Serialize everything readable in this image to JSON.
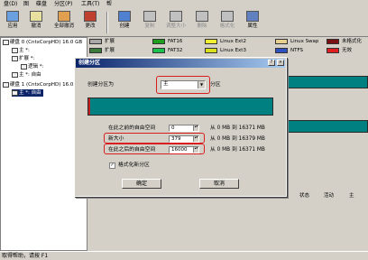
{
  "menubar": [
    "盘(D)",
    "图",
    "碟盘",
    "分区(P)",
    "工具(T)",
    "帮"
  ],
  "toolbar": {
    "buttons": [
      {
        "label": "应用",
        "icon": "apply-icon",
        "enabled": true
      },
      {
        "label": "撤消",
        "icon": "undo-icon",
        "enabled": true
      },
      {
        "label": "全部撤消",
        "icon": "undo-all-icon",
        "enabled": true
      },
      {
        "label": "更改",
        "icon": "change-icon",
        "enabled": true
      },
      {
        "label": "创建",
        "icon": "create-icon",
        "enabled": true
      },
      {
        "label": "复制",
        "icon": "copy-icon",
        "enabled": false
      },
      {
        "label": "调整大小",
        "icon": "resize-icon",
        "enabled": false
      },
      {
        "label": "删除",
        "icon": "delete-icon",
        "enabled": false
      },
      {
        "label": "格式化",
        "icon": "format-icon",
        "enabled": false
      },
      {
        "label": "属性",
        "icon": "properties-icon",
        "enabled": true
      }
    ]
  },
  "legend": [
    {
      "label": "扩展",
      "color": "#a8a8a8"
    },
    {
      "label": "FAT16",
      "color": "#1ea01e"
    },
    {
      "label": "Linux Ext2",
      "color": "#f0f030"
    },
    {
      "label": "Linux Swap",
      "color": "#e8d090"
    },
    {
      "label": "未格式化",
      "color": "#7a1010"
    },
    {
      "label": "扩展",
      "color": "#3a7a3a"
    },
    {
      "label": "FAT32",
      "color": "#20c050"
    },
    {
      "label": "Linux Ext3",
      "color": "#d8e020"
    },
    {
      "label": "NTFS",
      "color": "#3050c0"
    },
    {
      "label": "无效",
      "color": "#e02020"
    }
  ],
  "tree": {
    "items": [
      {
        "label": "硬盘 0 (CntxCorpHD) 16.0 GB"
      },
      {
        "label": "主 *:"
      },
      {
        "label": "扩展 *:"
      },
      {
        "label": "逻辑 *:"
      },
      {
        "label": "主 *: 自由"
      },
      {
        "label": "硬盘 1 (CntxCorpHD) 16.0 GB"
      },
      {
        "label": "主 *: 自由"
      }
    ]
  },
  "list_headers": [
    "状态",
    "活动",
    "主"
  ],
  "statusbar": {
    "text": "取得帮助，请按 F1"
  },
  "dialog": {
    "title": "创建分区",
    "help_glyph": "?",
    "close_glyph": "×",
    "create_as_label": "创建分区为",
    "create_as_value": "主",
    "create_as_suffix": "分区",
    "free_before_label": "在此之前的自由空间",
    "free_before_value": "0",
    "new_size_label": "新大小",
    "new_size_value": "379",
    "free_after_label": "在此之后的自由空间",
    "free_after_value": "16000",
    "range_before": "从 0 MB 到 16371 MB",
    "range_size": "从 0 MB 到 16379 MB",
    "range_after": "从 0 MB 到 16371 MB",
    "format_label": "格式化新分区",
    "format_checked": true,
    "ok_label": "确定",
    "cancel_label": "取消",
    "dropdown_arrow": "▼",
    "check_glyph": "✓",
    "spin_glyph": "▴▾"
  }
}
